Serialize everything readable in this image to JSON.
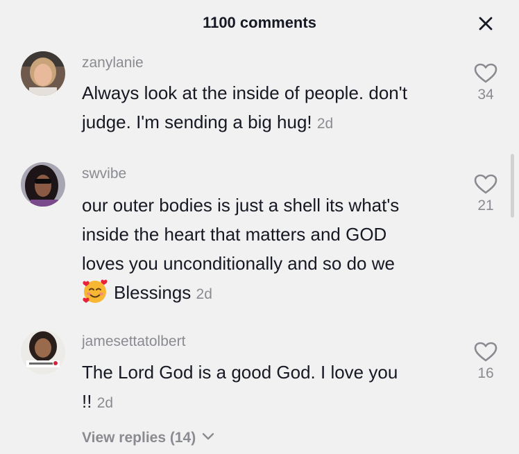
{
  "header": {
    "title": "1100 comments",
    "close_icon": "close-icon"
  },
  "comments": [
    {
      "username": "zanylanie",
      "text": "Always look at the inside of people. don't judge. I'm sending a big hug!",
      "time": "2d",
      "likes": "34"
    },
    {
      "username": "swvibe",
      "text_line1": "our outer bodies is just a shell its what's",
      "text_line2": "inside the heart that matters and GOD",
      "text_line3": "loves you unconditionally and so do we",
      "emoji": "smiling-face-with-hearts",
      "text_line4": "Blessings",
      "time": "2d",
      "likes": "21"
    },
    {
      "username": "jamesettatolbert",
      "text": "The Lord God is a good God. I love you !!",
      "time": "2d",
      "likes": "16",
      "view_replies": "View replies (14)"
    }
  ],
  "colors": {
    "background": "#f1f1f1",
    "text": "#161823",
    "muted": "#8a8b91"
  }
}
